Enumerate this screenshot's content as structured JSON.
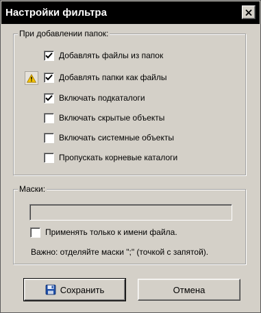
{
  "window": {
    "title": "Настройки фильтра"
  },
  "add_folders_group": {
    "legend": "При добавлении папок:",
    "options": [
      {
        "label": "Добавлять файлы из папок",
        "checked": true
      },
      {
        "label": "Добавлять папки как файлы",
        "checked": true
      },
      {
        "label": "Включать подкаталоги",
        "checked": true
      },
      {
        "label": "Включать скрытые объекты",
        "checked": false
      },
      {
        "label": "Включать системные объекты",
        "checked": false
      },
      {
        "label": "Пропускать корневые каталоги",
        "checked": false
      }
    ],
    "warning_icon": "warning-icon"
  },
  "masks_group": {
    "legend": "Маски:",
    "mask_value": "",
    "filename_only_label": "Применять только к имени файла.",
    "filename_only_checked": false,
    "note": "Важно: отделяйте маски \";\" (точкой с запятой)."
  },
  "buttons": {
    "save_label": "Сохранить",
    "save_icon": "floppy-disk-icon",
    "cancel_label": "Отмена"
  },
  "colors": {
    "face": "#d4d0c8",
    "titlebar": "#000000",
    "warning": "#f5c400",
    "save_icon": "#1f4fa8"
  }
}
